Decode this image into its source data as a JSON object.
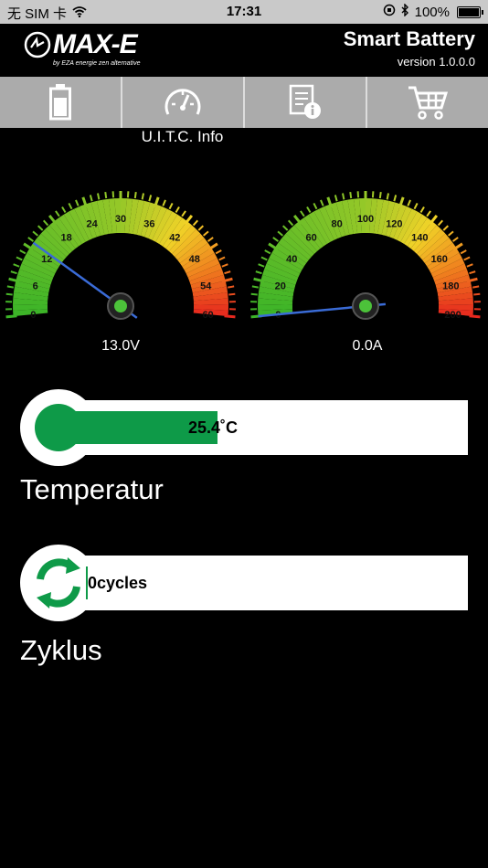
{
  "status_bar": {
    "carrier": "无 SIM 卡",
    "time": "17:31",
    "battery": "100%"
  },
  "header": {
    "logo_text": "MAX-E",
    "logo_tagline": "by EZA energie zen alternative",
    "title": "Smart Battery",
    "version": "version 1.0.0.0"
  },
  "tabs": [
    {
      "icon": "battery-icon"
    },
    {
      "icon": "speedometer-icon",
      "label": "U.I.T.C. Info"
    },
    {
      "icon": "document-info-icon"
    },
    {
      "icon": "shopping-cart-icon"
    }
  ],
  "gauges": [
    {
      "name": "voltage",
      "min": 0,
      "max": 60,
      "ticks": [
        "0",
        "6",
        "12",
        "18",
        "24",
        "30",
        "36",
        "42",
        "48",
        "54",
        "60"
      ],
      "value": 13.0,
      "readout": "13.0V"
    },
    {
      "name": "current",
      "min": 0,
      "max": 200,
      "ticks": [
        "0",
        "20",
        "40",
        "60",
        "80",
        "100",
        "120",
        "140",
        "160",
        "180",
        "200"
      ],
      "value": 0.0,
      "readout": "0.0A"
    }
  ],
  "temperature": {
    "value_text": "25.4˚C",
    "fill_fraction": 0.4,
    "label": "Temperatur"
  },
  "cycles": {
    "value_text": "0cycles",
    "label": "Zyklus"
  },
  "colors": {
    "accent_green": "#0e9a48",
    "tab_gray": "#ababab",
    "status_gray": "#c9c9c9"
  }
}
